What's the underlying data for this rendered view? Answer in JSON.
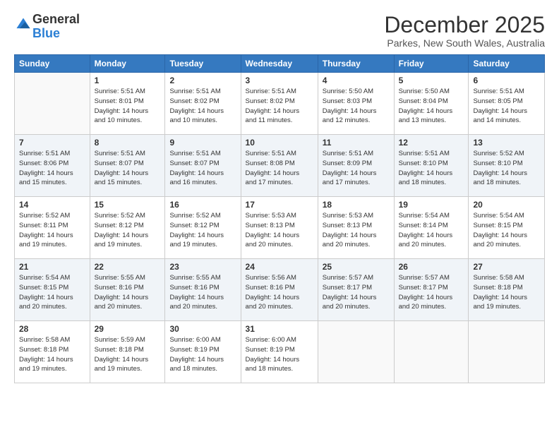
{
  "logo": {
    "general": "General",
    "blue": "Blue"
  },
  "header": {
    "month": "December 2025",
    "location": "Parkes, New South Wales, Australia"
  },
  "weekdays": [
    "Sunday",
    "Monday",
    "Tuesday",
    "Wednesday",
    "Thursday",
    "Friday",
    "Saturday"
  ],
  "weeks": [
    [
      {
        "day": "",
        "info": ""
      },
      {
        "day": "1",
        "info": "Sunrise: 5:51 AM\nSunset: 8:01 PM\nDaylight: 14 hours\nand 10 minutes."
      },
      {
        "day": "2",
        "info": "Sunrise: 5:51 AM\nSunset: 8:02 PM\nDaylight: 14 hours\nand 10 minutes."
      },
      {
        "day": "3",
        "info": "Sunrise: 5:51 AM\nSunset: 8:02 PM\nDaylight: 14 hours\nand 11 minutes."
      },
      {
        "day": "4",
        "info": "Sunrise: 5:50 AM\nSunset: 8:03 PM\nDaylight: 14 hours\nand 12 minutes."
      },
      {
        "day": "5",
        "info": "Sunrise: 5:50 AM\nSunset: 8:04 PM\nDaylight: 14 hours\nand 13 minutes."
      },
      {
        "day": "6",
        "info": "Sunrise: 5:51 AM\nSunset: 8:05 PM\nDaylight: 14 hours\nand 14 minutes."
      }
    ],
    [
      {
        "day": "7",
        "info": "Sunrise: 5:51 AM\nSunset: 8:06 PM\nDaylight: 14 hours\nand 15 minutes."
      },
      {
        "day": "8",
        "info": "Sunrise: 5:51 AM\nSunset: 8:07 PM\nDaylight: 14 hours\nand 15 minutes."
      },
      {
        "day": "9",
        "info": "Sunrise: 5:51 AM\nSunset: 8:07 PM\nDaylight: 14 hours\nand 16 minutes."
      },
      {
        "day": "10",
        "info": "Sunrise: 5:51 AM\nSunset: 8:08 PM\nDaylight: 14 hours\nand 17 minutes."
      },
      {
        "day": "11",
        "info": "Sunrise: 5:51 AM\nSunset: 8:09 PM\nDaylight: 14 hours\nand 17 minutes."
      },
      {
        "day": "12",
        "info": "Sunrise: 5:51 AM\nSunset: 8:10 PM\nDaylight: 14 hours\nand 18 minutes."
      },
      {
        "day": "13",
        "info": "Sunrise: 5:52 AM\nSunset: 8:10 PM\nDaylight: 14 hours\nand 18 minutes."
      }
    ],
    [
      {
        "day": "14",
        "info": "Sunrise: 5:52 AM\nSunset: 8:11 PM\nDaylight: 14 hours\nand 19 minutes."
      },
      {
        "day": "15",
        "info": "Sunrise: 5:52 AM\nSunset: 8:12 PM\nDaylight: 14 hours\nand 19 minutes."
      },
      {
        "day": "16",
        "info": "Sunrise: 5:52 AM\nSunset: 8:12 PM\nDaylight: 14 hours\nand 19 minutes."
      },
      {
        "day": "17",
        "info": "Sunrise: 5:53 AM\nSunset: 8:13 PM\nDaylight: 14 hours\nand 20 minutes."
      },
      {
        "day": "18",
        "info": "Sunrise: 5:53 AM\nSunset: 8:13 PM\nDaylight: 14 hours\nand 20 minutes."
      },
      {
        "day": "19",
        "info": "Sunrise: 5:54 AM\nSunset: 8:14 PM\nDaylight: 14 hours\nand 20 minutes."
      },
      {
        "day": "20",
        "info": "Sunrise: 5:54 AM\nSunset: 8:15 PM\nDaylight: 14 hours\nand 20 minutes."
      }
    ],
    [
      {
        "day": "21",
        "info": "Sunrise: 5:54 AM\nSunset: 8:15 PM\nDaylight: 14 hours\nand 20 minutes."
      },
      {
        "day": "22",
        "info": "Sunrise: 5:55 AM\nSunset: 8:16 PM\nDaylight: 14 hours\nand 20 minutes."
      },
      {
        "day": "23",
        "info": "Sunrise: 5:55 AM\nSunset: 8:16 PM\nDaylight: 14 hours\nand 20 minutes."
      },
      {
        "day": "24",
        "info": "Sunrise: 5:56 AM\nSunset: 8:16 PM\nDaylight: 14 hours\nand 20 minutes."
      },
      {
        "day": "25",
        "info": "Sunrise: 5:57 AM\nSunset: 8:17 PM\nDaylight: 14 hours\nand 20 minutes."
      },
      {
        "day": "26",
        "info": "Sunrise: 5:57 AM\nSunset: 8:17 PM\nDaylight: 14 hours\nand 20 minutes."
      },
      {
        "day": "27",
        "info": "Sunrise: 5:58 AM\nSunset: 8:18 PM\nDaylight: 14 hours\nand 19 minutes."
      }
    ],
    [
      {
        "day": "28",
        "info": "Sunrise: 5:58 AM\nSunset: 8:18 PM\nDaylight: 14 hours\nand 19 minutes."
      },
      {
        "day": "29",
        "info": "Sunrise: 5:59 AM\nSunset: 8:18 PM\nDaylight: 14 hours\nand 19 minutes."
      },
      {
        "day": "30",
        "info": "Sunrise: 6:00 AM\nSunset: 8:19 PM\nDaylight: 14 hours\nand 18 minutes."
      },
      {
        "day": "31",
        "info": "Sunrise: 6:00 AM\nSunset: 8:19 PM\nDaylight: 14 hours\nand 18 minutes."
      },
      {
        "day": "",
        "info": ""
      },
      {
        "day": "",
        "info": ""
      },
      {
        "day": "",
        "info": ""
      }
    ]
  ]
}
